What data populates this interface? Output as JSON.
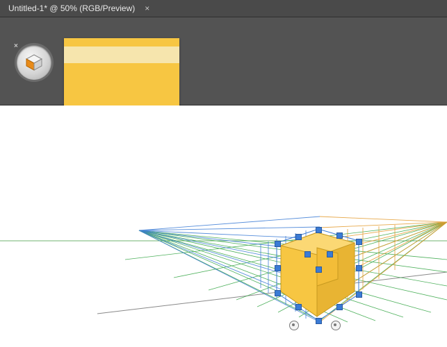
{
  "tab": {
    "title": "Untitled-1* @ 50% (RGB/Preview)",
    "close_glyph": "×"
  },
  "perspective_widget": {
    "close_glyph": "×"
  },
  "swatch": {
    "fill": "#f7c642",
    "highlight": "#f6e5ad"
  },
  "grid": {
    "left_color": "#3a7bd5",
    "right_color": "#e39a2b",
    "floor_color": "#3aa84a",
    "shape_fill": "#f7c642"
  }
}
